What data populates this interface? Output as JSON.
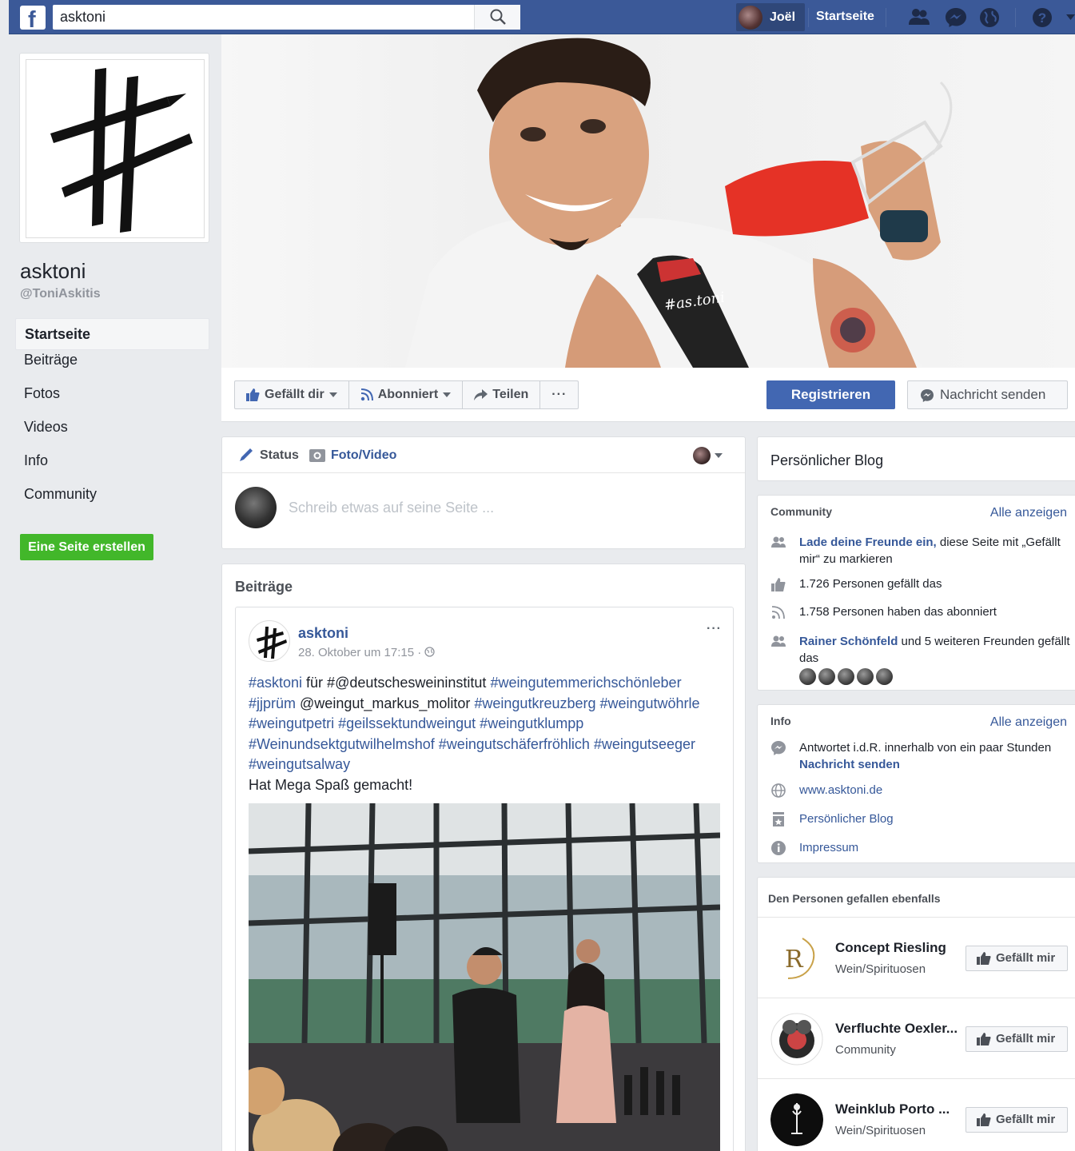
{
  "topbar": {
    "search_value": "asktoni",
    "user_name": "Joël",
    "home_label": "Startseite"
  },
  "page": {
    "name": "asktoni",
    "handle": "@ToniAskitis"
  },
  "leftnav": {
    "items": [
      "Startseite",
      "Beiträge",
      "Fotos",
      "Videos",
      "Info",
      "Community"
    ],
    "create_page": "Eine Seite erstellen"
  },
  "actions": {
    "like": "Gefällt dir",
    "follow": "Abonniert",
    "share": "Teilen",
    "more": "···",
    "register": "Registrieren",
    "message": "Nachricht senden"
  },
  "composer": {
    "tab_status": "Status",
    "tab_photo": "Foto/Video",
    "placeholder": "Schreib etwas auf seine Seite ..."
  },
  "posts": {
    "title": "Beiträge",
    "post": {
      "author": "asktoni",
      "time": "28. Oktober um 17:15 · ",
      "dots": "···",
      "text_lines": [
        [
          "#asktoni",
          " für #@deutschesweininstitut ",
          "#weingutemmerichschönleber"
        ],
        [
          "#jjprüm",
          " @weingut_markus_molitor ",
          "#weingutkreuzberg #weingutwöhrle"
        ],
        [
          "#weingutpetri #geilssektundweingut #weingutklumpp",
          "",
          ""
        ],
        [
          "#Weinundsektgutwilhelmshof #weingutschäferfröhlich #weingutseeger",
          "",
          ""
        ],
        [
          "#weingutsalway",
          "",
          ""
        ]
      ],
      "closing": "Hat Mega Spaß gemacht!"
    }
  },
  "right": {
    "blog_title": "Persönlicher Blog",
    "community": {
      "title": "Community",
      "see_all": "Alle anzeigen",
      "invite_link": "Lade deine Freunde ein,",
      "invite_rest": " diese Seite mit „Gefällt mir“ zu markieren",
      "likes": "1.726 Personen gefällt das",
      "followers": "1.758 Personen haben das abonniert",
      "friend_name": "Rainer Schönfeld",
      "friend_rest": " und 5 weiteren Freunden gefällt das"
    },
    "info": {
      "title": "Info",
      "see_all": "Alle anzeigen",
      "response": "Antwortet i.d.R. innerhalb von ein paar Stunden",
      "send_message": "Nachricht senden",
      "website": "www.asktoni.de",
      "blog": "Persönlicher Blog",
      "imprint": "Impressum"
    },
    "also_liked": {
      "title": "Den Personen gefallen ebenfalls",
      "button": "Gefällt mir",
      "items": [
        {
          "name": "Concept Riesling",
          "category": "Wein/Spirituosen"
        },
        {
          "name": "Verfluchte Oexler...",
          "category": "Community"
        },
        {
          "name": "Weinklub Porto ...",
          "category": "Wein/Spirituosen"
        }
      ]
    }
  }
}
